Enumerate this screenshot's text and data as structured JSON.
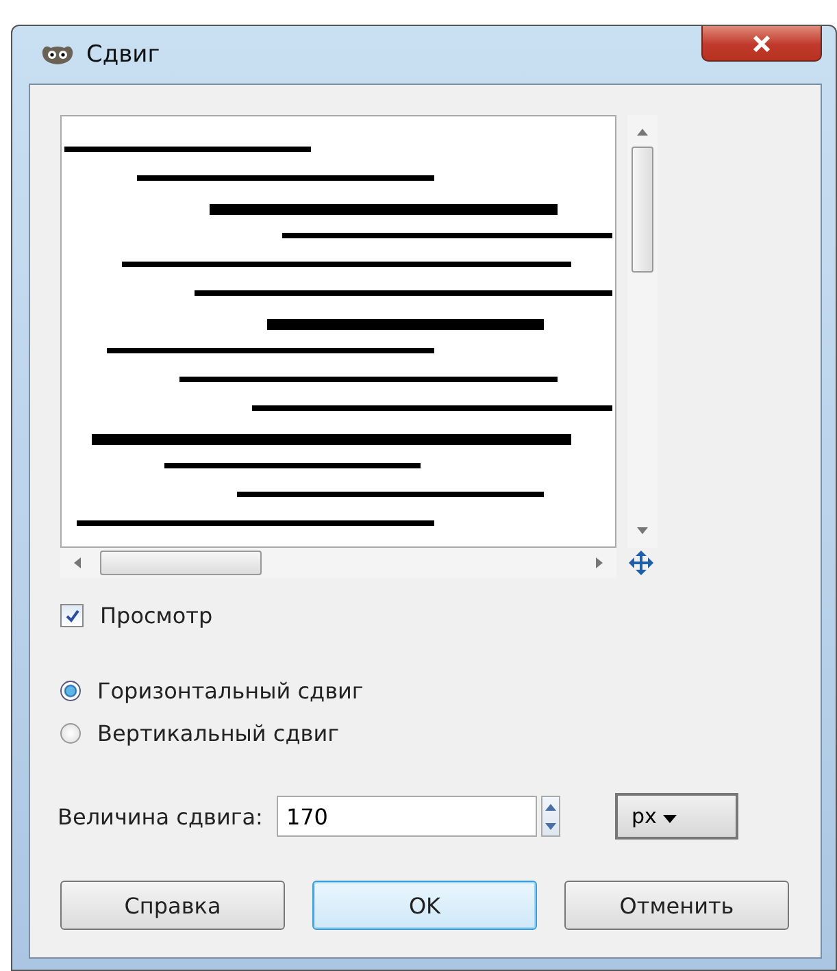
{
  "window": {
    "title": "Сдвиг"
  },
  "preview": {
    "kind": "picture",
    "checkbox": {
      "label": "Просмотр",
      "checked": true
    }
  },
  "direction": [
    {
      "label": "Горизонтальный сдвиг",
      "selected": true
    },
    {
      "label": "Вертикальный сдвиг",
      "selected": false
    }
  ],
  "amount": {
    "label": "Величина сдвига:",
    "value": "170",
    "unit": "px"
  },
  "buttons": [
    {
      "label": "Справка",
      "default": false
    },
    {
      "label": "OK",
      "default": true
    },
    {
      "label": "Отменить",
      "default": false
    }
  ]
}
